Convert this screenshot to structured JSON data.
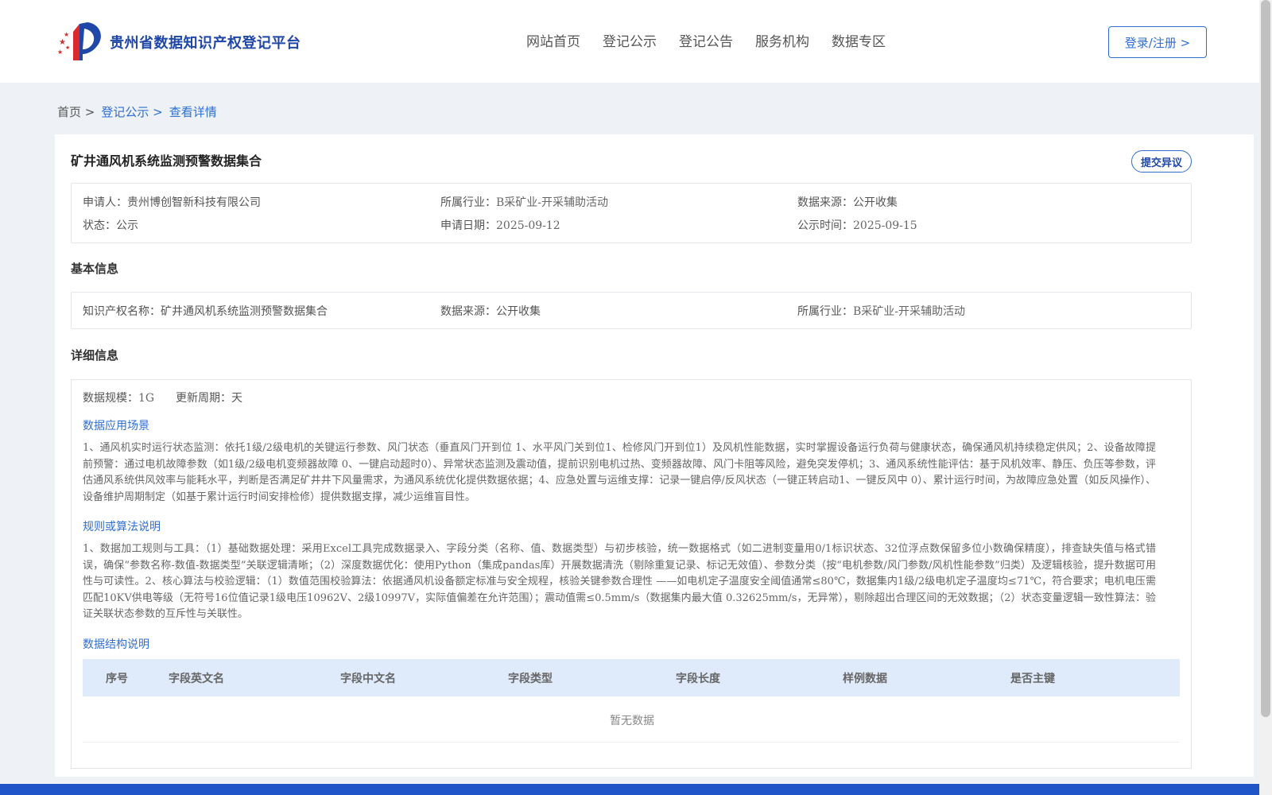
{
  "header": {
    "site_title": "贵州省数据知识产权登记平台",
    "nav": [
      "网站首页",
      "登记公示",
      "登记公告",
      "服务机构",
      "数据专区"
    ],
    "login_label": "登录/注册 >"
  },
  "breadcrumb": {
    "home": "首页 >",
    "list": "登记公示 >",
    "current": "查看详情"
  },
  "record": {
    "title": "矿井通风机系统监测预警数据集合",
    "objection_label": "提交异议",
    "summary": {
      "applicant_label": "申请人：",
      "applicant": "贵州博创智新科技有限公司",
      "industry_label": "所属行业：",
      "industry": "B采矿业-开采辅助活动",
      "source_label": "数据来源：",
      "source": "公开收集",
      "status_label": "状态：",
      "status": "公示",
      "apply_date_label": "申请日期：",
      "apply_date": "2025-09-12",
      "publish_date_label": "公示时间：",
      "publish_date": "2025-09-15"
    }
  },
  "basic": {
    "section_title": "基本信息",
    "ip_name_label": "知识产权名称：",
    "ip_name": "矿井通风机系统监测预警数据集合",
    "source_label": "数据来源：",
    "source": "公开收集",
    "industry_label": "所属行业：",
    "industry": "B采矿业-开采辅助活动"
  },
  "detail": {
    "section_title": "详细信息",
    "scale_label": "数据规模：",
    "scale": "1G",
    "cycle_label": "更新周期：",
    "cycle": "天",
    "scenario_title": "数据应用场景",
    "scenario_text": "1、通风机实时运行状态监测：依托1级/2级电机的关键运行参数、风门状态（垂直风门开到位 1、水平风门关到位1、检修风门开到位1）及风机性能数据，实时掌握设备运行负荷与健康状态，确保通风机持续稳定供风；2、设备故障提前预警：通过电机故障参数（如1级/2级电机变频器故障 0、一键启动超时0）、异常状态监测及震动值，提前识别电机过热、变频器故障、风门卡阻等风险，避免突发停机；3、通风系统性能评估：基于风机效率、静压、负压等参数，评估通风系统供风效率与能耗水平，判断是否满足矿井井下风量需求，为通风系统优化提供数据依据；4、应急处置与运维支撑：记录一键启停/反风状态（一键正转启动1、一键反风中 0）、累计运行时间，为故障应急处置（如反风操作）、设备维护周期制定（如基于累计运行时间安排检修）提供数据支撑，减少运维盲目性。",
    "rules_title": "规则或算法说明",
    "rules_text": "1、数据加工规则与工具：（1）基础数据处理：采用Excel工具完成数据录入、字段分类（名称、值、数据类型）与初步核验，统一数据格式（如二进制变量用0/1标识状态、32位浮点数保留多位小数确保精度），排查缺失值与格式错误，确保“参数名称-数值-数据类型”关联逻辑清晰；（2）深度数据优化：使用Python（集成pandas库）开展数据清洗（剔除重复记录、标记无效值）、参数分类（按“电机参数/风门参数/风机性能参数”归类）及逻辑核验，提升数据可用性与可读性。2、核心算法与校验逻辑：（1）数值范围校验算法：依据通风机设备额定标准与安全规程，核验关键参数合理性 ——如电机定子温度安全阈值通常≤80℃，数据集内1级/2级电机定子温度均≤71℃，符合要求；电机电压需匹配10KV供电等级（无符号16位值记录1级电压10962V、2级10997V，实际值偏差在允许范围）；震动值需≤0.5mm/s（数据集内最大值 0.32625mm/s，无异常），剔除超出合理区间的无效数据；（2）状态变量逻辑一致性算法：验证关联状态参数的互斥性与关联性。",
    "structure_title": "数据结构说明",
    "table_headers": [
      "序号",
      "字段英文名",
      "字段中文名",
      "字段类型",
      "字段长度",
      "样例数据",
      "是否主键"
    ],
    "empty_text": "暂无数据"
  },
  "colors": {
    "accent": "#2f6fd0",
    "brand": "#1f47a8",
    "table_header_bg": "#dfeafb",
    "footer": "#1f55c8"
  }
}
